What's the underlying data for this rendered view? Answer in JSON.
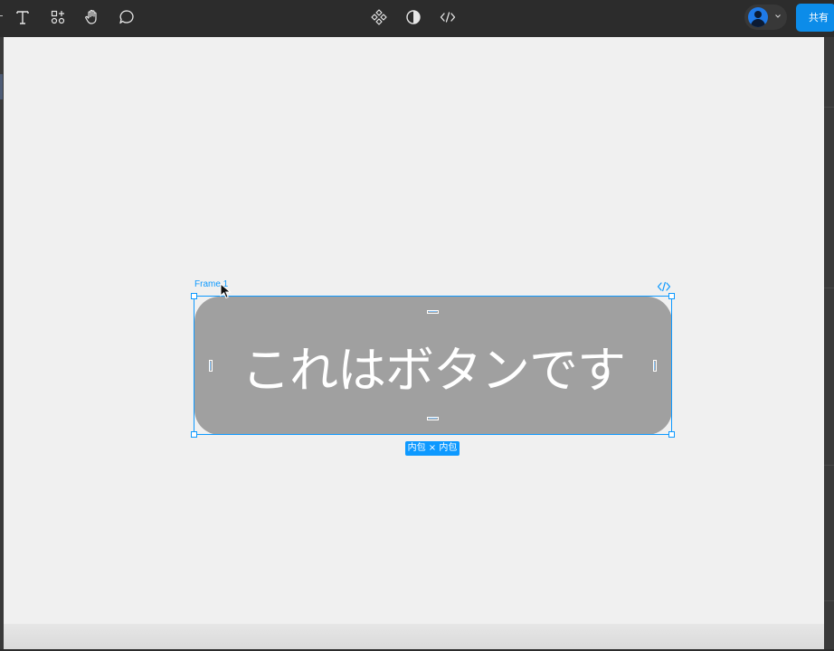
{
  "toolbar": {
    "tools": [
      {
        "name": "text-tool",
        "icon": "text-T-icon"
      },
      {
        "name": "resources-tool",
        "icon": "shapes-grid-icon"
      },
      {
        "name": "hand-tool",
        "icon": "hand-icon"
      },
      {
        "name": "comment-tool",
        "icon": "speech-bubble-icon"
      }
    ],
    "center_tools": [
      {
        "name": "components",
        "icon": "component-diamond-icon"
      },
      {
        "name": "theme",
        "icon": "half-circle-contrast-icon"
      },
      {
        "name": "dev-mode",
        "icon": "code-brackets-icon"
      }
    ],
    "share_label": "共有"
  },
  "canvas": {
    "background": "#f0f0f0",
    "frame_label": "Frame 1",
    "button_text": "これはボタンです",
    "button_color": "#a0a0a0",
    "selection_color": "#0d99ff",
    "size_badge": "内包 × 内包"
  }
}
